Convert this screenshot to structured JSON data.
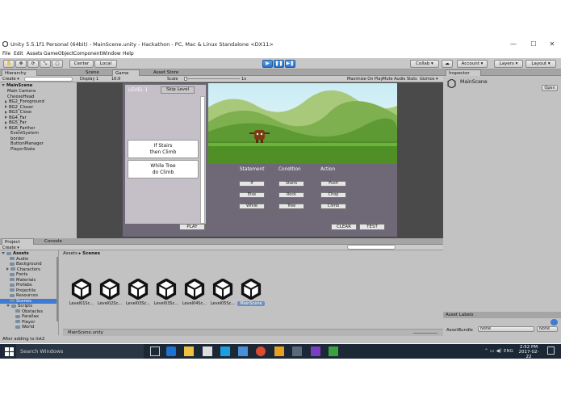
{
  "window": {
    "title": "Unity 5.5.1f1 Personal (64bit) - MainScene.unity - Hackathon - PC, Mac & Linux Standalone <DX11>",
    "minimize": "—",
    "maximize": "☐",
    "close": "✕"
  },
  "menu": [
    "File",
    "Edit",
    "Assets",
    "GameObject",
    "Component",
    "Window",
    "Help"
  ],
  "toolbar": {
    "center": "Center",
    "local": "Local",
    "play": "▶",
    "pause": "❚❚",
    "step": "▶❚",
    "collab": "Collab ▾",
    "cloud": "☁",
    "account": "Account ▾",
    "layers": "Layers ▾",
    "layout": "Layout ▾"
  },
  "hierarchy": {
    "tab": "Hierarchy",
    "create": "Create ▾",
    "scene": "MainScene",
    "items": [
      "Main Camera",
      "CheeseHead",
      "BG2_Foreground",
      "BG2_Closer",
      "BG3_Close",
      "BG4_Far",
      "BG5_Far",
      "BG6_Farther",
      "EventSystem",
      "border",
      "ButtonManager",
      "PlayerState"
    ]
  },
  "sceneTabs": {
    "scene": "Scene",
    "game": "Game",
    "store": "Asset Store"
  },
  "gameBar": {
    "display": "Display 1",
    "aspect": "16:9",
    "scale": "Scale",
    "scaleVal": "1x",
    "maximize": "Maximize On Play",
    "mute": "Mute Audio",
    "stats": "Stats",
    "gizmos": "Gizmos ▾"
  },
  "game": {
    "level": "LEVEL 1",
    "skip": "Skip Level",
    "cards": [
      [
        "If Stairs",
        "then Climb"
      ],
      [
        "While Tree",
        "do Climb"
      ]
    ],
    "headers": {
      "statement": "Statement",
      "condition": "Condition",
      "action": "Action"
    },
    "statements": [
      "If",
      "Else",
      "While"
    ],
    "conditions": [
      "Stairs",
      "Rock",
      "Tree"
    ],
    "actions": [
      "Push",
      "Chop",
      "Climb"
    ],
    "play": "PLAY",
    "clear": "CLEAR",
    "test": "TEST"
  },
  "inspector": {
    "tab": "Inspector",
    "object": "MainScene",
    "open": "Open",
    "labels": "Asset Labels",
    "bundle": "AssetBundle",
    "none1": "None",
    "none2": "None"
  },
  "project": {
    "tab": "Project",
    "console": "Console",
    "create": "Create ▾",
    "assetsRoot": "Assets",
    "tree": [
      "Audio",
      "Background",
      "Characters",
      "Fonts",
      "Materials",
      "Prefabs",
      "Projectile",
      "Resources",
      "Scenes",
      "Scripts",
      "Obstacles",
      "Parallax",
      "Player",
      "World"
    ],
    "breadcrumb1": "Assets",
    "breadcrumb2": "Scenes",
    "files": [
      "Level01Sc...",
      "Level02Sc...",
      "Level03Sc...",
      "Level03Sc...",
      "Level04Sc...",
      "Level05Sc...",
      "MainScene"
    ],
    "footer": "MainScene.unity",
    "status": "After adding to list2"
  },
  "taskbar": {
    "search": "Search Windows",
    "time": "2:52 PM",
    "date": "2017-02-22",
    "lang": "ENG"
  },
  "colors": {
    "accent": "#3e7bd3",
    "gameBg": "#6e6877",
    "taskbar": "#1c2836"
  }
}
